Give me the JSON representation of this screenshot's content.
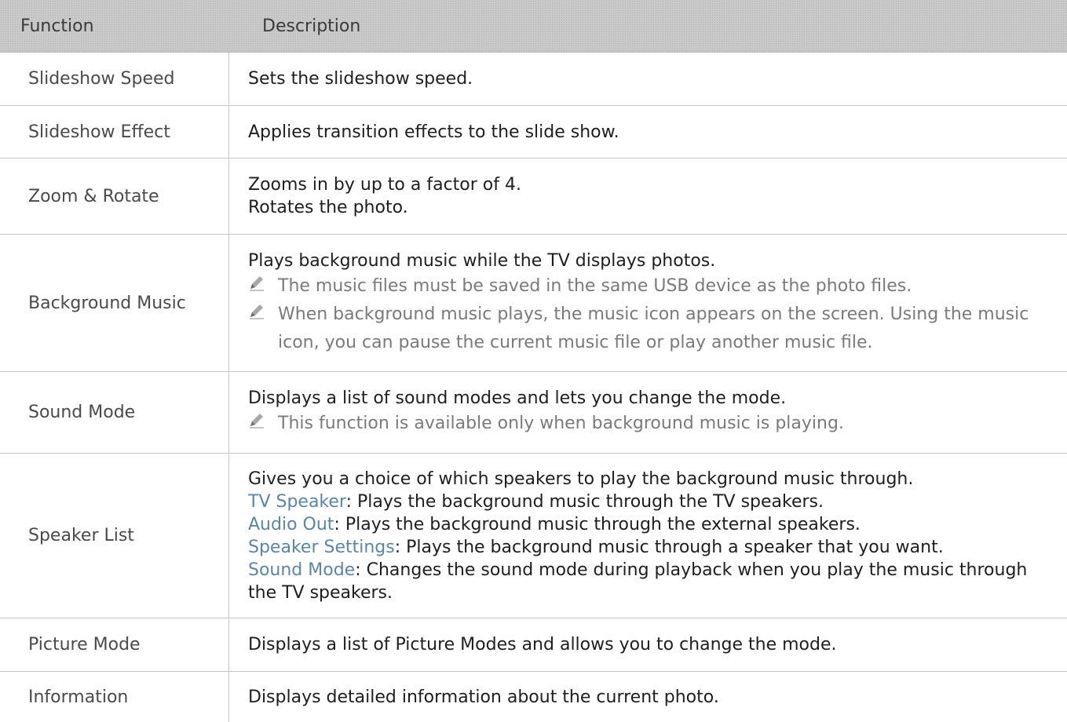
{
  "header": {
    "function": "Function",
    "description": "Description"
  },
  "rows": [
    {
      "function": "Slideshow Speed",
      "lines": [
        "Sets the slideshow speed."
      ]
    },
    {
      "function": "Slideshow Effect",
      "lines": [
        "Applies transition effects to the slide show."
      ]
    },
    {
      "function": "Zoom & Rotate",
      "lines": [
        "Zooms in by up to a factor of 4.",
        "Rotates the photo."
      ]
    },
    {
      "function": "Background Music",
      "lines": [
        "Plays background music while the TV displays photos."
      ],
      "notes": [
        "The music files must be saved in the same USB device as the photo files.",
        "When background music plays, the music icon appears on the screen. Using the music icon, you can pause the current music file or play another music file."
      ]
    },
    {
      "function": "Sound Mode",
      "lines": [
        "Displays a list of sound modes and lets you change the mode."
      ],
      "notes": [
        "This function is available only when background music is playing."
      ]
    },
    {
      "function": "Speaker List",
      "lines": [
        "Gives you a choice of which speakers to play the background music through."
      ],
      "options": [
        {
          "label": "TV Speaker",
          "text": ": Plays the background music through the TV speakers."
        },
        {
          "label": "Audio Out",
          "text": ": Plays the background music through the external speakers."
        },
        {
          "label": "Speaker Settings",
          "text": ": Plays the background music through a speaker that you want."
        },
        {
          "label": "Sound Mode",
          "text": ": Changes the sound mode during playback when you play the music through the TV speakers."
        }
      ]
    },
    {
      "function": "Picture Mode",
      "lines": [
        "Displays a list of Picture Modes and allows you to change the mode."
      ]
    },
    {
      "function": "Information",
      "lines": [
        "Displays detailed information about the current photo."
      ]
    }
  ],
  "icons": {
    "note": "pencil-note-icon"
  },
  "colors": {
    "header_bg": "#c9c9c9",
    "option_label": "#5a86a8",
    "note_text": "#7a7a7a"
  }
}
